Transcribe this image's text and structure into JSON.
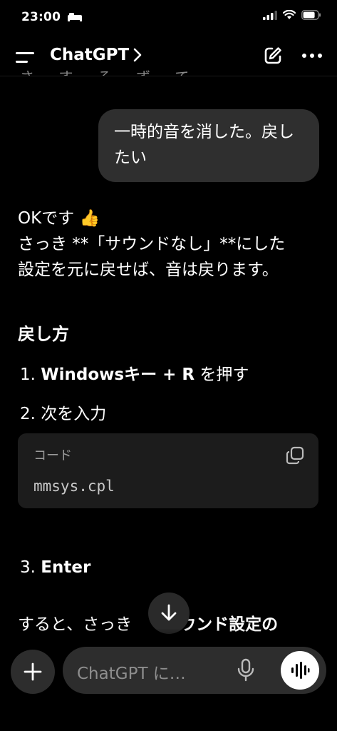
{
  "status": {
    "time": "23:00"
  },
  "header": {
    "title": "ChatGPT",
    "chevron": "›"
  },
  "peek_text": "さ す る ず て",
  "user_message": "一時的音を消した。戻したい",
  "assistant": {
    "line1": "OKです 👍",
    "line2": "さっき **「サウンドなし」**にした",
    "line3": "設定を元に戻せば、音は戻ります。",
    "section_title": "戻し方",
    "step1_num": "1.",
    "step1_bold": "Windowsキー + R",
    "step1_rest": " を押す",
    "step2_num": "2.",
    "step2": "次を入力",
    "code_label": "コード",
    "code": "mmsys.cpl",
    "step3_num": "3.",
    "step3_bold": "Enter",
    "bottom_text_a": "すると、さっき",
    "bottom_text_b": "サウンド設定の"
  },
  "composer": {
    "placeholder": "ChatGPT に…"
  },
  "icons": {
    "menu": "menu-icon",
    "edit": "new-chat-icon",
    "more": "more-icon",
    "copy": "copy-icon",
    "scroll": "arrow-down-icon",
    "plus": "plus-icon",
    "mic": "mic-icon",
    "voice": "voice-mode-icon"
  }
}
